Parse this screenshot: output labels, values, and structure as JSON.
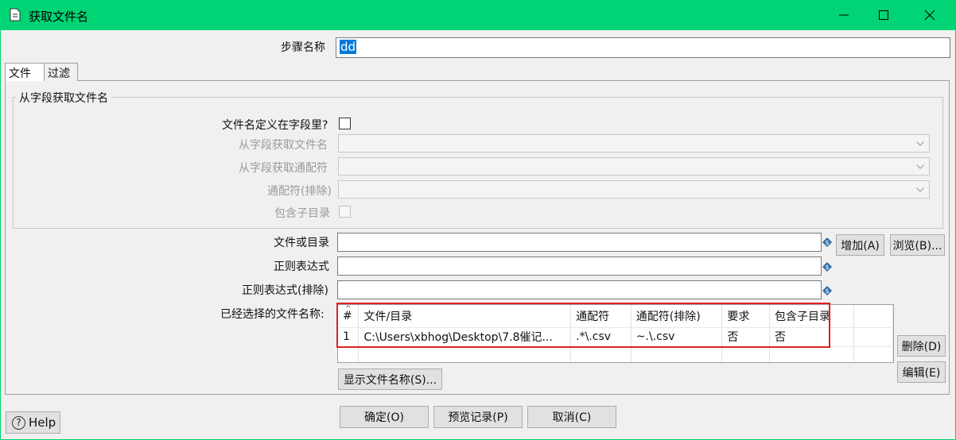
{
  "window": {
    "title": "获取文件名",
    "accent": "#00d474"
  },
  "step": {
    "label": "步骤名称",
    "value": "dd"
  },
  "tabs": [
    {
      "label": "文件"
    },
    {
      "label": "过滤"
    }
  ],
  "group": {
    "title": "从字段获取文件名",
    "filename_defined_label": "文件名定义在字段里?",
    "get_filename_label": "从字段获取文件名",
    "get_wildcard_label": "从字段获取通配符",
    "exclude_wildcard_label": "通配符(排除)",
    "include_subdirs_label": "包含子目录"
  },
  "file_section": {
    "file_or_dir_label": "文件或目录",
    "regex_label": "正则表达式",
    "regex_exclude_label": "正则表达式(排除)",
    "add_button": "增加(A)",
    "browse_button": "浏览(B)...",
    "selected_files_label": "已经选择的文件名称:",
    "delete_button": "删除(D)",
    "edit_button": "编辑(E)",
    "show_files_button": "显示文件名称(S)..."
  },
  "table": {
    "columns": [
      "#",
      "文件/目录",
      "通配符",
      "通配符(排除)",
      "要求",
      "包含子目录"
    ],
    "rows": [
      [
        "1",
        "C:\\Users\\xbhog\\Desktop\\7.8催记...",
        ".*\\.csv",
        "~.\\.csv",
        "否",
        "否"
      ]
    ]
  },
  "footer": {
    "help": "Help",
    "ok": "确定(O)",
    "preview": "预览记录(P)",
    "cancel": "取消(C)"
  }
}
